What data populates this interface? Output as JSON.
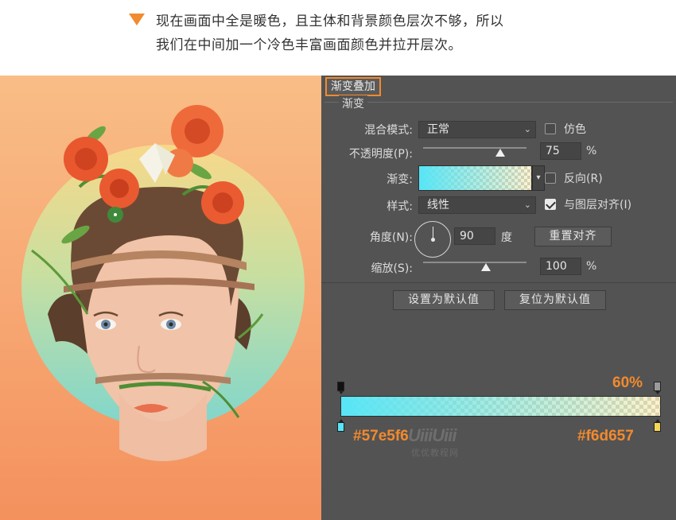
{
  "caption": {
    "line1": "现在画面中全是暖色，且主体和背景颜色层次不够，所以",
    "line2": "我们在中间加一个冷色丰富画面颜色并拉开层次。"
  },
  "panel": {
    "title": "渐变叠加",
    "group_title": "渐变",
    "blend_mode": {
      "label": "混合模式:",
      "value": "正常"
    },
    "dither": {
      "label": "仿色",
      "checked": false
    },
    "opacity": {
      "label": "不透明度(P):",
      "value": "75",
      "unit": "%",
      "fraction": 0.75
    },
    "gradient": {
      "label": "渐变:"
    },
    "reverse": {
      "label": "反向(R)",
      "checked": false
    },
    "style": {
      "label": "样式:",
      "value": "线性"
    },
    "align_layer": {
      "label": "与图层对齐(I)",
      "checked": true
    },
    "angle": {
      "label": "角度(N):",
      "value": "90",
      "unit": "度"
    },
    "reset_align_button": "重置对齐",
    "scale": {
      "label": "缩放(S):",
      "value": "100",
      "unit": "%",
      "fraction": 0.6
    },
    "set_default_button": "设置为默认值",
    "reset_default_button": "复位为默认值"
  },
  "gradient_editor": {
    "opacity_annotation": "60%",
    "left_color": "#57e5f6",
    "right_color": "#f6d657",
    "watermark": "UiiiUiii",
    "watermark_sub": "优优教程网"
  },
  "icons": [
    "chevron-down-icon",
    "checkbox-icon",
    "angle-dial-icon",
    "gradient-stop-icon",
    "triangle-bullet-icon"
  ]
}
